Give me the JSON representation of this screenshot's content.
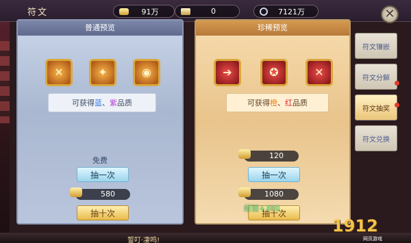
{
  "window": {
    "title": "符文"
  },
  "resources": [
    {
      "icon": "gold-ingot-icon",
      "value": "91万"
    },
    {
      "icon": "ticket-icon",
      "value": "0"
    },
    {
      "icon": "silver-coin-icon",
      "value": "7121万"
    }
  ],
  "panels": {
    "normal": {
      "title": "普通预览",
      "gems": [
        "✕",
        "✦",
        "◉"
      ],
      "quality": {
        "prefix": "可获得",
        "q1": "蓝",
        "sep": "、",
        "q2": "紫",
        "suffix": "品质"
      },
      "free_label": "免费",
      "draw_one": "抽一次",
      "ten_price": "580",
      "draw_ten": "抽十次"
    },
    "rare": {
      "title": "珍稀预览",
      "gems": [
        "➔",
        "✪",
        "✕"
      ],
      "quality": {
        "prefix": "可获得",
        "q1": "橙",
        "sep": "、",
        "q2": "红",
        "suffix": "品质"
      },
      "one_price": "120",
      "draw_one": "抽一次",
      "ten_price": "1080",
      "draw_ten": "抽十次",
      "exp": "经验+380"
    }
  },
  "tabs": [
    {
      "label": "符文镶嵌",
      "active": false
    },
    {
      "label": "符文分解",
      "active": false
    },
    {
      "label": "符文抽奖",
      "active": true
    },
    {
      "label": "符文兑换",
      "active": false
    }
  ],
  "bottom_text": "誓叮·凄鸣!",
  "watermark": {
    "brand": "1912",
    "sub": "网页游戏"
  },
  "colors": {
    "blue": "#2f7be6",
    "purple": "#b444d8",
    "orange": "#e98316",
    "red": "#e02a2a"
  }
}
